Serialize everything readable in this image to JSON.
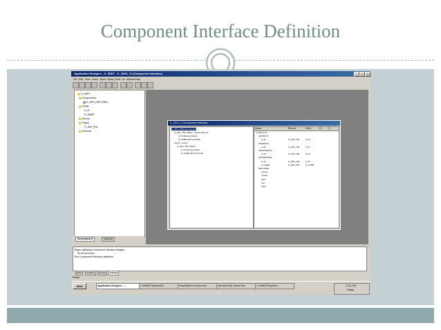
{
  "slide": {
    "title": "Component Interface Definition"
  },
  "app": {
    "title": "Application Designer - S_SDET - S_JDH1_CI (Component Interface)",
    "window_buttons": [
      "_",
      "□",
      "x"
    ],
    "menu": [
      "File",
      "Edit",
      "View",
      "Insert",
      "Build",
      "Debug",
      "Tools",
      "Go",
      "Window",
      "Help"
    ],
    "project_tree": [
      "S_SDET",
      "Components",
      "S_JDN_CMP (GBL)",
      "Fields",
      "S_ID",
      "S_NAME",
      "Menus",
      "Pages",
      "S_JDN_PNL",
      "Records"
    ],
    "left_tabs": [
      "Development",
      "Upgrade"
    ],
    "child": {
      "title": "S_JDH1_CI (Component Interface)",
      "left_rows": [
        "S_JDN_CMP (Component)",
        "S_JDN_TBL (Table) - Search Record",
        "S_ID (Record Field)",
        "S_NAME (Record Field)",
        "Scroll - Level 0",
        "S_JDN_TBL (Table)",
        "S_ID (Record Field)",
        "S_NAME (Record Field)"
      ],
      "right_headers": [
        "Name",
        "Record",
        "Field",
        "R...",
        "C..."
      ],
      "right_rows": [
        {
          "name": "S_JDH1_CI",
          "record": "",
          "field": ""
        },
        {
          "name": "GETKEYS",
          "record": "",
          "field": ""
        },
        {
          "name": "S_ID",
          "record": "S_JDN_TBL",
          "field": "S_ID"
        },
        {
          "name": "FINDKEYS",
          "record": "",
          "field": ""
        },
        {
          "name": "S_ID",
          "record": "S_JDN_TBL",
          "field": "S_ID"
        },
        {
          "name": "CREATEKEYS",
          "record": "",
          "field": ""
        },
        {
          "name": "S_ID",
          "record": "S_JDN_TBL",
          "field": "S_ID"
        },
        {
          "name": "PROPERTIES",
          "record": "",
          "field": ""
        },
        {
          "name": "S_ID",
          "record": "S_JDN_TBL",
          "field": "S_ID"
        },
        {
          "name": "S_NAME",
          "record": "S_JDN_TBL",
          "field": "S_NAME"
        },
        {
          "name": "METHODS",
          "record": "",
          "field": ""
        },
        {
          "name": "Cancel",
          "record": "",
          "field": ""
        },
        {
          "name": "Create",
          "record": "",
          "field": ""
        },
        {
          "name": "Find",
          "record": "",
          "field": ""
        },
        {
          "name": "Get",
          "record": "",
          "field": ""
        },
        {
          "name": "Save",
          "record": "",
          "field": ""
        }
      ]
    },
    "output_lines": [
      "Begin validating Component Interface integrity ...",
      "No errors found.",
      "End Component Interface validation."
    ],
    "output_tabs": [
      "Build",
      "Upgrade",
      "Results",
      "Validate"
    ],
    "status": "Ready",
    "taskbar": {
      "start": "Start",
      "tasks": [
        "Application Designer - ...",
        "C:\\WINNT\\System32\\...",
        "PeopleSoft 8 session exp...",
        "Microsoft SQL Server Ma...",
        "C:\\WINNT\\Explorer..."
      ],
      "clock": "12:21 PM",
      "day": "Friday"
    }
  }
}
